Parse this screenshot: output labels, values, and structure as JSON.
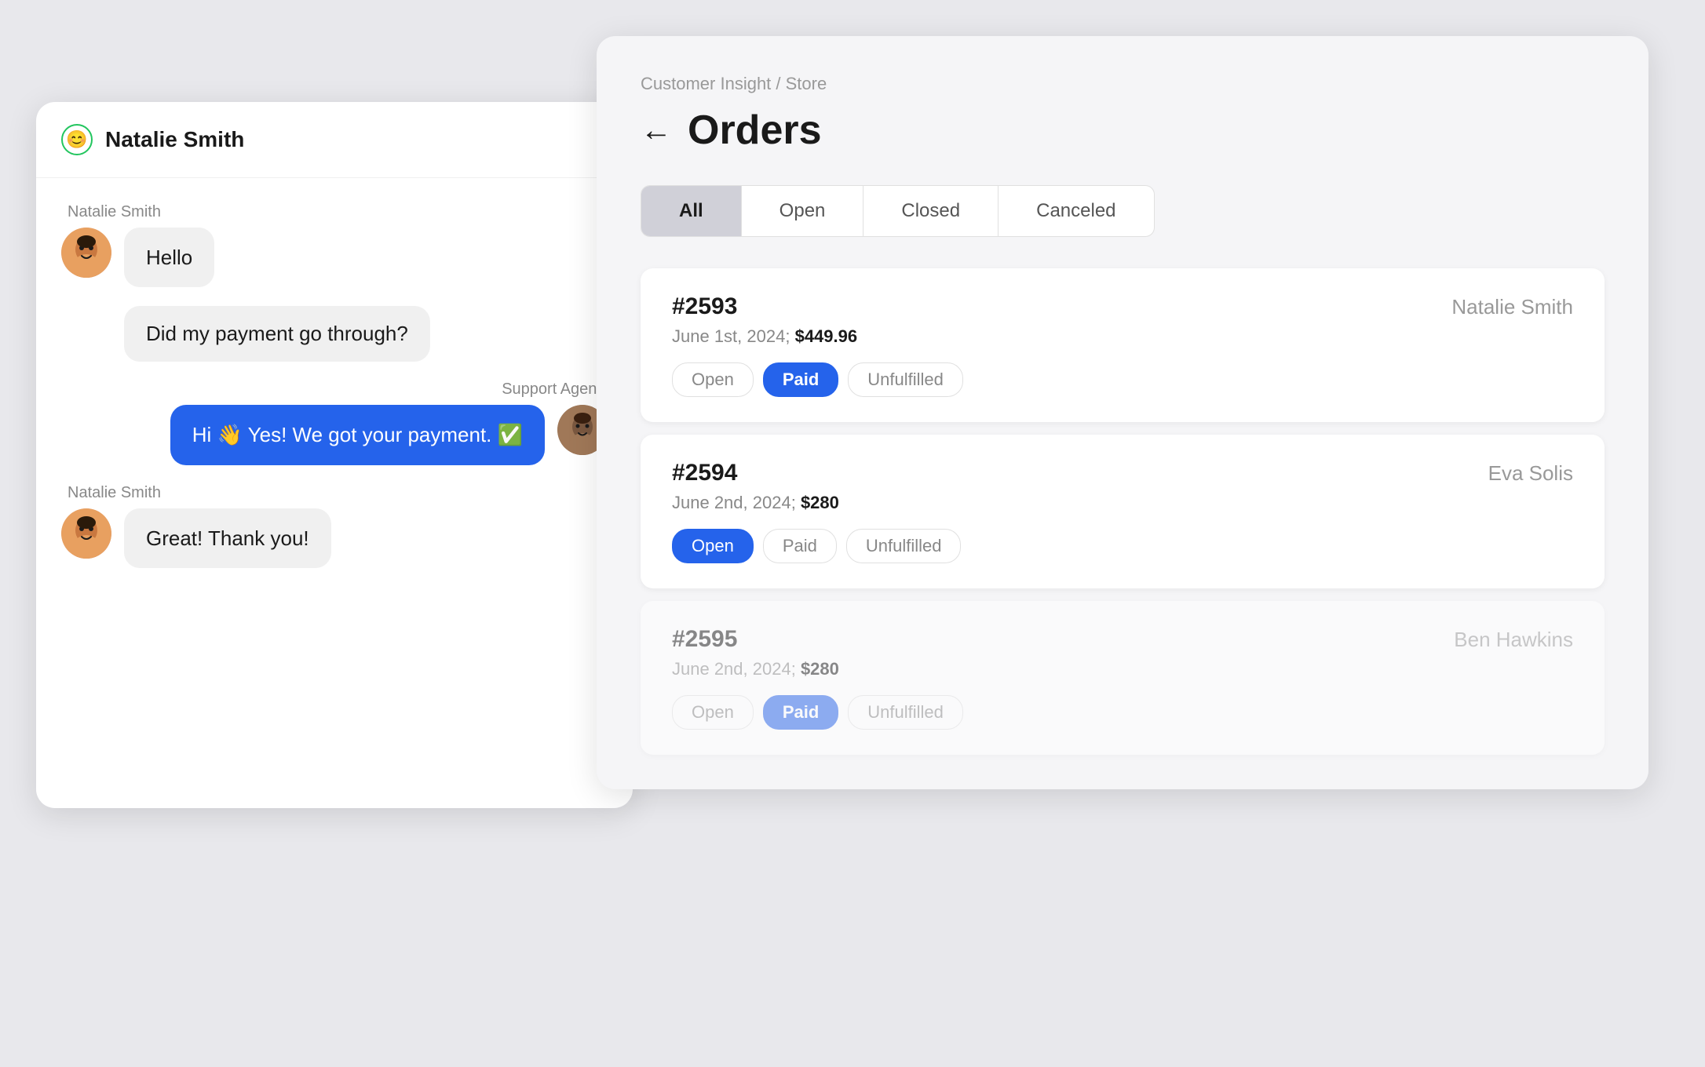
{
  "chat": {
    "header": {
      "icon": "😊",
      "name": "Natalie Smith"
    },
    "messages": [
      {
        "id": 1,
        "type": "customer",
        "sender": "Natalie Smith",
        "text": "Hello",
        "hasAvatar": true
      },
      {
        "id": 2,
        "type": "customer-standalone",
        "text": "Did my payment go through?",
        "hasAvatar": false
      },
      {
        "id": 3,
        "type": "agent",
        "sender": "Support Agent",
        "text": "Hi 👋 Yes! We got your payment. ✅",
        "hasAvatar": true
      },
      {
        "id": 4,
        "type": "customer",
        "sender": "Natalie Smith",
        "text": "Great! Thank you!",
        "hasAvatar": true
      }
    ]
  },
  "orders": {
    "breadcrumb": "Customer Insight / Store",
    "title": "Orders",
    "back_arrow": "←",
    "tabs": [
      {
        "label": "All",
        "active": true
      },
      {
        "label": "Open",
        "active": false
      },
      {
        "label": "Closed",
        "active": false
      },
      {
        "label": "Canceled",
        "active": false
      }
    ],
    "items": [
      {
        "number": "#2593",
        "customer": "Natalie Smith",
        "date": "June 1st, 2024;",
        "amount": "$449.96",
        "tags": [
          {
            "label": "Open",
            "style": "normal"
          },
          {
            "label": "Paid",
            "style": "active"
          },
          {
            "label": "Unfulfilled",
            "style": "normal"
          }
        ],
        "faded": false
      },
      {
        "number": "#2594",
        "customer": "Eva Solis",
        "date": "June 2nd, 2024;",
        "amount": "$280",
        "tags": [
          {
            "label": "Open",
            "style": "open-active"
          },
          {
            "label": "Paid",
            "style": "normal"
          },
          {
            "label": "Unfulfilled",
            "style": "normal"
          }
        ],
        "faded": false
      },
      {
        "number": "#2595",
        "customer": "Ben Hawkins",
        "date": "June 2nd, 2024;",
        "amount": "$280",
        "tags": [
          {
            "label": "Open",
            "style": "normal"
          },
          {
            "label": "Paid",
            "style": "active-faded"
          },
          {
            "label": "Unfulfilled",
            "style": "normal"
          }
        ],
        "faded": true
      }
    ]
  },
  "colors": {
    "accent_blue": "#2563eb",
    "tag_active_bg": "#2563eb",
    "tag_active_text": "#ffffff",
    "tab_active_bg": "#d0d0d8"
  }
}
